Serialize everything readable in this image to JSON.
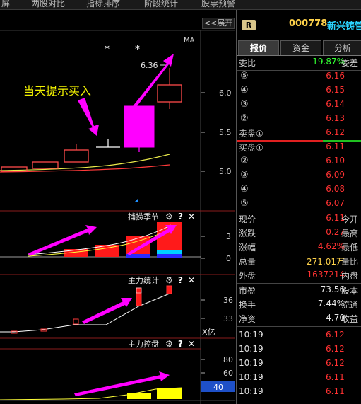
{
  "top_tabs": [
    "屏",
    "两股对比",
    "指标排序",
    "阶段统计",
    "股票预警"
  ],
  "collapse_label": "<<展开",
  "main_chart": {
    "ma_label": "MA",
    "annotation": "当天提示买入",
    "high_label": "6.36",
    "star": "*",
    "y_ticks": [
      "6.0",
      "5.5",
      "5.0"
    ]
  },
  "panels": [
    {
      "title": "捕捞季节",
      "y_ticks": [
        "3",
        "0"
      ]
    },
    {
      "title": "主力统计",
      "y_ticks": [
        "36",
        "33"
      ],
      "unit": "X亿"
    },
    {
      "title": "主力控盘",
      "y_ticks": [
        "80",
        "60"
      ],
      "value_box": "40"
    }
  ],
  "tool_icons": {
    "gear": "⚙",
    "help": "?",
    "close": "✕"
  },
  "quote": {
    "badge": "R",
    "code": "000778",
    "name": "新兴铸管",
    "tabs": [
      "报价",
      "资金",
      "分析"
    ],
    "weibi_label": "委比",
    "weibi_value": "-19.87%",
    "weicha_label": "委差",
    "sell": [
      {
        "label": "⑤",
        "price": "6.16"
      },
      {
        "label": "④",
        "price": "6.15"
      },
      {
        "label": "③",
        "price": "6.14"
      },
      {
        "label": "②",
        "price": "6.13"
      },
      {
        "label": "卖盘①",
        "price": "6.12"
      }
    ],
    "buy": [
      {
        "label": "买盘①",
        "price": "6.11"
      },
      {
        "label": "②",
        "price": "6.10"
      },
      {
        "label": "③",
        "price": "6.09"
      },
      {
        "label": "④",
        "price": "6.08"
      },
      {
        "label": "⑤",
        "price": "6.07"
      }
    ],
    "stats": [
      {
        "label": "现价",
        "value": "6.11",
        "color": "#ff3232",
        "label2": "今开"
      },
      {
        "label": "涨跌",
        "value": "0.27",
        "color": "#ff3232",
        "label2": "最高"
      },
      {
        "label": "涨幅",
        "value": "4.62%",
        "color": "#ff3232",
        "label2": "最低"
      },
      {
        "label": "总量",
        "value": "271.01万",
        "color": "#ffd24a",
        "label2": "量比"
      },
      {
        "label": "外盘",
        "value": "1637214",
        "color": "#ff3232",
        "label2": "内盘"
      }
    ],
    "stats2": [
      {
        "label": "市盈",
        "value": "73.56",
        "label2": "股本"
      },
      {
        "label": "换手",
        "value": "7.44%",
        "label2": "流通"
      },
      {
        "label": "净资",
        "value": "4.70",
        "label2": "收益"
      }
    ],
    "ticks": [
      {
        "time": "10:19",
        "price": "6.12",
        "color": "#ff3232"
      },
      {
        "time": "10:19",
        "price": "6.12",
        "color": "#ff3232"
      },
      {
        "time": "10:19",
        "price": "6.12",
        "color": "#ff3232"
      },
      {
        "time": "10:19",
        "price": "6.11",
        "color": "#ff3232"
      },
      {
        "time": "10:19",
        "price": "6.11",
        "color": "#ff3232"
      }
    ]
  }
}
